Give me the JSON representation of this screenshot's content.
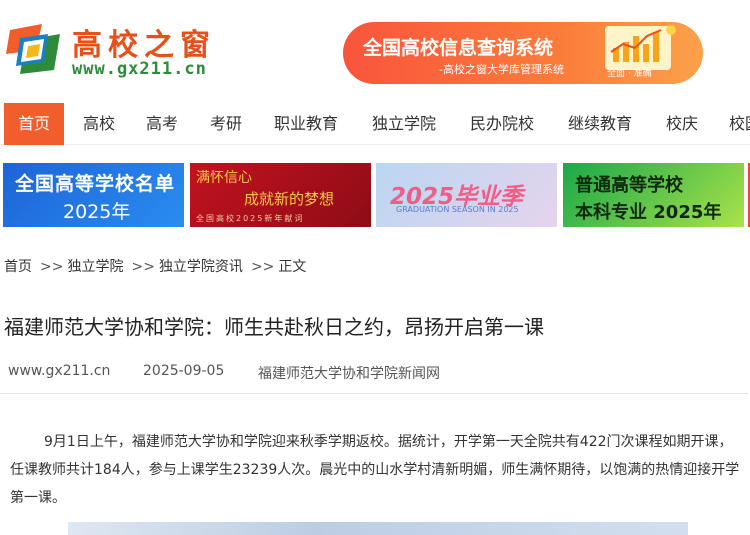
{
  "header": {
    "logo_title": "高校之窗",
    "logo_url": "www.gx211.cn",
    "ad_title": "全国高校信息查询系统",
    "ad_subtitle": "-高校之窗大学库管理系统",
    "ad_tag": "全面 · 准确"
  },
  "nav": {
    "items": [
      "首页",
      "高校",
      "高考",
      "考研",
      "职业教育",
      "独立学院",
      "民办院校",
      "继续教育",
      "校庆",
      "校园"
    ]
  },
  "promos": {
    "p1_line1": "全国高等学校名单",
    "p1_line2": "2025年",
    "p2_line1": "满怀信心",
    "p2_line2": "成就新的梦想",
    "p2_line3": "全国高校2025新年献词",
    "p3_line1": "2025毕业季",
    "p3_line2": "GRADUATION SEASON IN 2025",
    "p4_line1": "普通高等学校",
    "p4_line2": "本科专业 2025年"
  },
  "breadcrumb": {
    "items": [
      "首页",
      "独立学院",
      "独立学院资讯",
      "正文"
    ],
    "separator": ">>"
  },
  "article": {
    "title": "福建师范大学协和学院：师生共赴秋日之约，昂扬开启第一课",
    "source_site": "www.gx211.cn",
    "date": "2025-09-05",
    "source_name": "福建师范大学协和学院新闻网",
    "body": "9月1日上午，福建师范大学协和学院迎来秋季学期返校。据统计，开学第一天全院共有422门次课程如期开课，任课教师共计184人，参与上课学生23239人次。晨光中的山水学村清新明媚，师生满怀期待，以饱满的热情迎接开学第一课。"
  },
  "colors": {
    "brand_orange": "#f25d2c",
    "logo_green": "#2e8b3a"
  }
}
